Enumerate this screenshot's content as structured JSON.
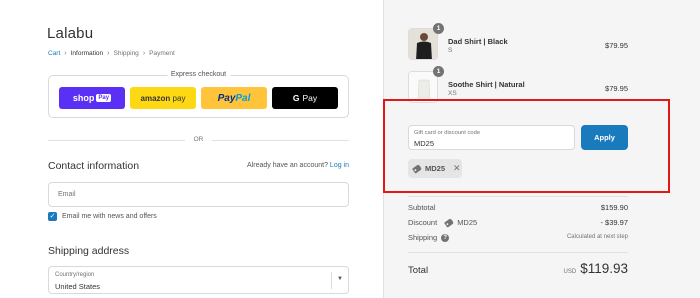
{
  "brand": "Lalabu",
  "breadcrumb": {
    "cart": "Cart",
    "information": "Information",
    "shipping": "Shipping",
    "payment": "Payment"
  },
  "express": {
    "title": "Express checkout",
    "shop_pay": "shop",
    "shop_pay_box": "Pay",
    "amazon_pay_a": "amazon",
    "amazon_pay_b": " pay",
    "paypal_a": "Pay",
    "paypal_b": "Pal",
    "gpay_g": "G",
    "gpay_pay": "Pay"
  },
  "or_label": "OR",
  "contact": {
    "title": "Contact information",
    "have_account": "Already have an account?",
    "login": "Log in",
    "email_placeholder": "Email",
    "newsletter": "Email me with news and offers",
    "newsletter_checked": true
  },
  "shipping_address": {
    "title": "Shipping address",
    "country_label": "Country/region",
    "country_value": "United States"
  },
  "cart_items": [
    {
      "qty": "1",
      "name": "Dad Shirt | Black",
      "variant": "S",
      "price": "$79.95"
    },
    {
      "qty": "1",
      "name": "Soothe Shirt | Natural",
      "variant": "XS",
      "price": "$79.95"
    }
  ],
  "discount": {
    "label": "Gift card or discount code",
    "value": "MD25",
    "apply": "Apply",
    "tag": "MD25"
  },
  "summary": {
    "subtotal_label": "Subtotal",
    "subtotal_value": "$159.90",
    "discount_label": "Discount",
    "discount_code": "MD25",
    "discount_value": "- $39.97",
    "shipping_label": "Shipping",
    "shipping_value": "Calculated at next step",
    "total_label": "Total",
    "currency": "USD",
    "total_value": "$119.93"
  },
  "colors": {
    "accent": "#197bbd",
    "highlight": "#e01818",
    "shop_pay": "#5a31f4",
    "paypal": "#ffc439",
    "amazon": "#ffd814"
  }
}
